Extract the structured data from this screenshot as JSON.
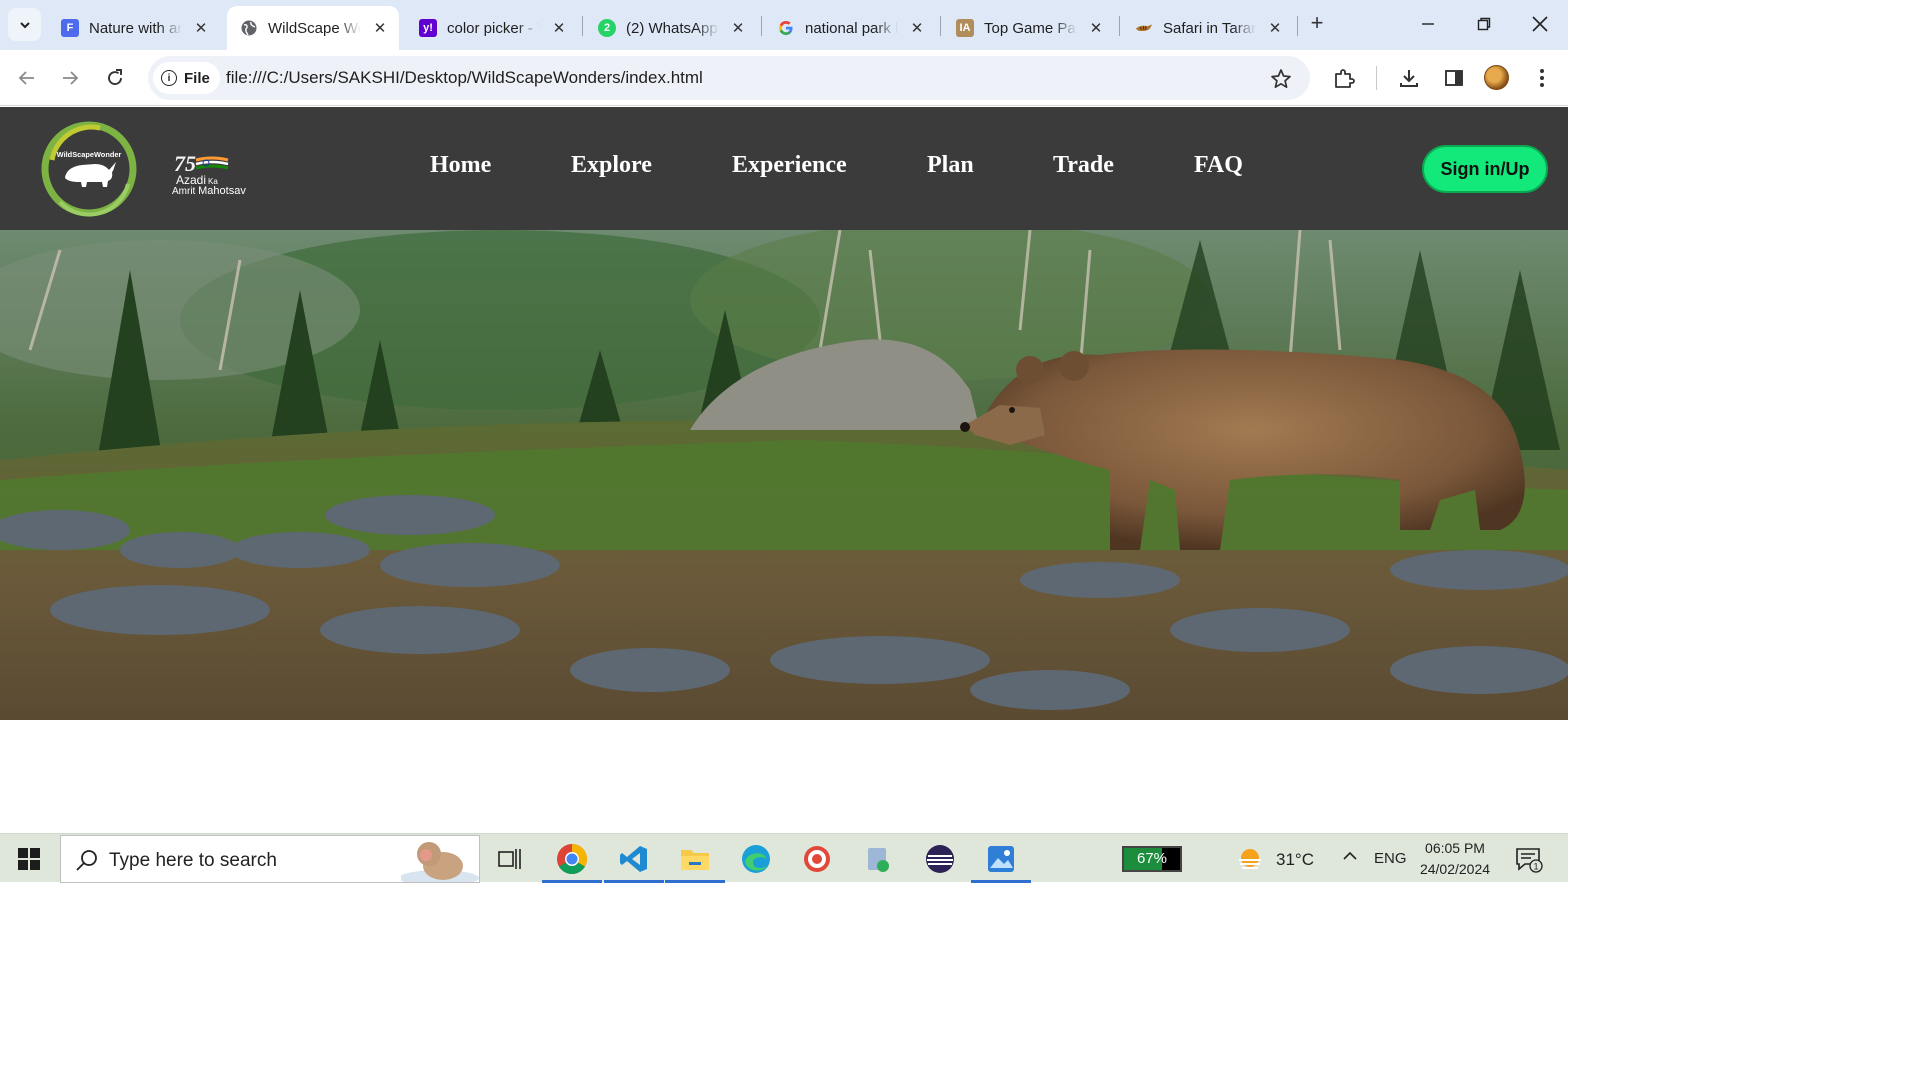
{
  "browser": {
    "tabs": [
      {
        "title": "Nature with an",
        "favicon": "forms-icon",
        "color": "#4f6bed"
      },
      {
        "title": "WildScape Wo",
        "favicon": "globe-icon",
        "active": true
      },
      {
        "title": "color picker - Y",
        "favicon": "yahoo-icon",
        "color": "#6001d2"
      },
      {
        "title": "(2) WhatsApp",
        "favicon": "whatsapp-icon",
        "color": "#25d366"
      },
      {
        "title": "national park l",
        "favicon": "google-icon"
      },
      {
        "title": "Top Game Par",
        "favicon": "ia-icon",
        "color": "#b08d5a"
      },
      {
        "title": "Safari in Taran",
        "favicon": "tiger-icon"
      }
    ],
    "chip_label": "File",
    "url": "file:///C:/Users/SAKSHI/Desktop/WildScapeWonders/index.html"
  },
  "site": {
    "logo_text": "WildScapeWonder",
    "azadi": {
      "number": "75",
      "line1": "Azadi",
      "line1_small": "Ka",
      "line2a": "Amrit",
      "line2b": "Mahotsav"
    },
    "nav": [
      "Home",
      "Explore",
      "Experience",
      "Plan",
      "Trade",
      "FAQ"
    ],
    "signin_label": "Sign in/Up"
  },
  "taskbar": {
    "search_placeholder": "Type here to search",
    "battery_percent": 67,
    "battery_label": "67%",
    "temperature": "31°C",
    "language": "ENG",
    "time": "06:05 PM",
    "date": "24/02/2024",
    "notification_count": "1"
  },
  "colors": {
    "tabstrip": "#dee8f7",
    "site_header": "#3b3b3b",
    "signin": "#13e97a",
    "taskbar": "#dfe7da"
  }
}
